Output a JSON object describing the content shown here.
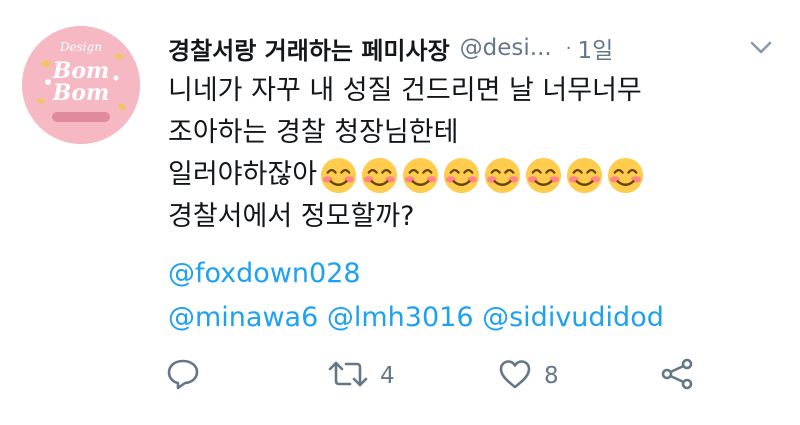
{
  "tweet": {
    "display_name": "경찰서랑 거래하는 페미사장",
    "handle": "@desi...",
    "separator": "·",
    "time": "1일",
    "avatar": {
      "logo_text_top": "Design",
      "logo_text_main1": "Bom",
      "logo_text_main2": "Bom",
      "colors": {
        "background": "#f6b9c4",
        "text": "#ffffff",
        "accent": "#f2c36b"
      }
    },
    "lines": [
      "니네가 자꾸 내 성질 건드리면 날 너무너무",
      "조아하는 경찰 청장님한테",
      "일러야하잖아",
      "경찰서에서 정모할까?"
    ],
    "emoji_count_label": "8",
    "emoji_icon": "smiling-face-with-smiling-eyes",
    "mentions_line1": [
      "@foxdown028"
    ],
    "mentions_line2": [
      "@minawa6",
      "@lmh3016",
      "@sidivudidod"
    ]
  },
  "actions": {
    "reply_icon": "reply-icon",
    "retweet_count": "4",
    "like_count": "8",
    "share_icon": "share-icon"
  },
  "colors": {
    "link": "#1da1f2",
    "muted": "#657786",
    "text": "#14171a"
  }
}
